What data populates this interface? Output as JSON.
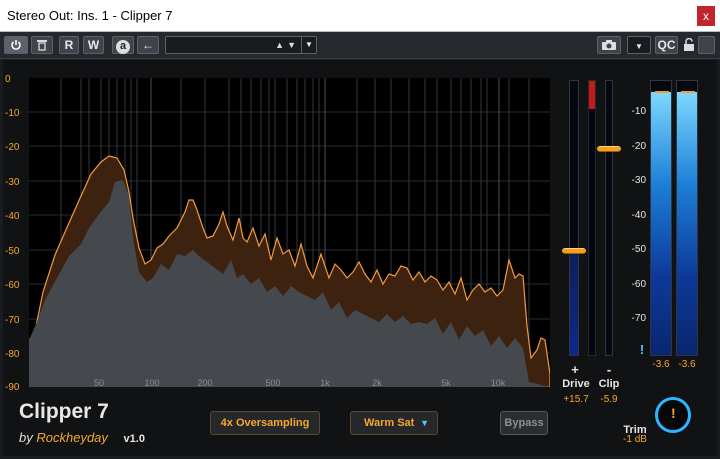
{
  "window": {
    "title": "Stereo Out: Ins. 1 - Clipper 7",
    "close_glyph": "x"
  },
  "toolbar": {
    "read_label": "R",
    "write_label": "W",
    "auto_label": "a",
    "preset_name": "",
    "qc_label": "QC"
  },
  "plugin": {
    "name": "Clipper 7",
    "by": "by",
    "vendor": "Rockheyday",
    "version": "v1.0",
    "oversampling_label": "4x Oversampling",
    "saturation_label": "Warm Sat",
    "bypass_label": "Bypass"
  },
  "spectrum": {
    "db_labels": [
      "0",
      "-10",
      "-20",
      "-30",
      "-40",
      "-50",
      "-60",
      "-70",
      "-80",
      "-90"
    ],
    "freq_labels": [
      "50",
      "100",
      "200",
      "500",
      "1k",
      "2k",
      "5k",
      "10k"
    ]
  },
  "drive": {
    "plus": "+",
    "label": "Drive",
    "value": "+15.7",
    "level": 0.38
  },
  "clip": {
    "minus": "-",
    "label": "Clip",
    "value": "-5.9",
    "level": 0.75
  },
  "output_meter": {
    "scale": [
      "-10",
      "-20",
      "-30",
      "-40",
      "-50",
      "-60",
      "-70"
    ],
    "left_value": "-3.6",
    "right_value": "-3.6",
    "left_level": 0.96,
    "right_level": 0.96,
    "alert": "!"
  },
  "trim": {
    "label": "Trim",
    "value": "-1 dB",
    "knob_glyph": "!"
  },
  "colors": {
    "accent": "#f5a830",
    "meter": "#4ec9ff",
    "close": "#c0262b"
  }
}
